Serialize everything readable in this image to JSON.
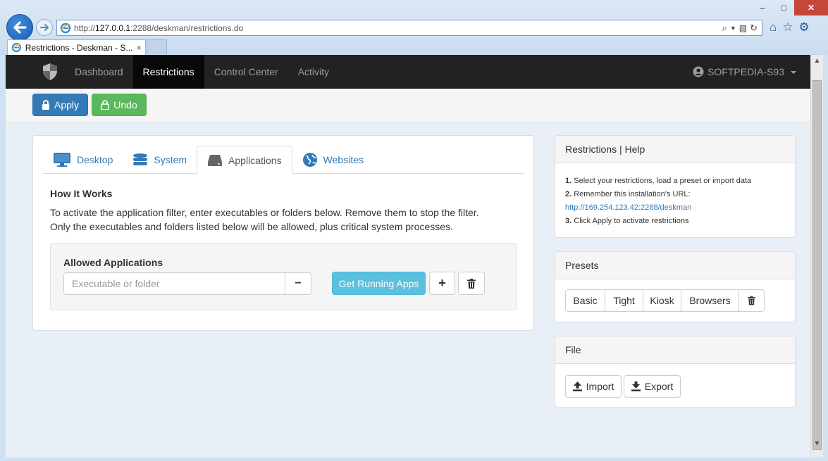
{
  "browser": {
    "url_scheme": "http://",
    "url_host": "127.0.0.1",
    "url_rest": ":2288/deskman/restrictions.do",
    "tab_title": "Restrictions - Deskman - S...",
    "tab_close": "×",
    "window_controls": {
      "minimize": "–",
      "maximize": "□",
      "close": "✕"
    },
    "tool_icons": [
      "home-icon",
      "star-icon",
      "gear-icon"
    ]
  },
  "navbar": {
    "items": [
      {
        "label": "Dashboard",
        "active": false
      },
      {
        "label": "Restrictions",
        "active": true
      },
      {
        "label": "Control Center",
        "active": false
      },
      {
        "label": "Activity",
        "active": false
      }
    ],
    "user": "SOFTPEDIA-S93"
  },
  "toolbar": {
    "apply": "Apply",
    "undo": "Undo"
  },
  "tabs": [
    {
      "label": "Desktop",
      "icon": "monitor-icon"
    },
    {
      "label": "System",
      "icon": "database-icon"
    },
    {
      "label": "Applications",
      "icon": "hard-drive-icon",
      "active": true
    },
    {
      "label": "Websites",
      "icon": "globe-icon"
    }
  ],
  "how": {
    "title": "How It Works",
    "line1": "To activate the application filter, enter executables or folders below. Remove them to stop the filter.",
    "line2": "Only the executables and folders listed below will be allowed, plus critical system processes."
  },
  "allowed": {
    "title": "Allowed Applications",
    "placeholder": "Executable or folder",
    "minus": "−",
    "running": "Get Running Apps",
    "plus": "+"
  },
  "help": {
    "title": "Restrictions | Help",
    "step1_num": "1.",
    "step1": "Select your restrictions, load a preset or import data",
    "step2_num": "2.",
    "step2": "Remember this installation's URL:",
    "url": "http://169.254.123.42:2288/deskman",
    "step3_num": "3.",
    "step3": "Click Apply to activate restrictions"
  },
  "presets": {
    "title": "Presets",
    "buttons": [
      "Basic",
      "Tight",
      "Kiosk",
      "Browsers"
    ]
  },
  "file": {
    "title": "File",
    "import": "Import",
    "export": "Export"
  },
  "colors": {
    "primary": "#337ab7",
    "success": "#5cb85c",
    "info": "#5bc0de",
    "navbar": "#222222"
  }
}
